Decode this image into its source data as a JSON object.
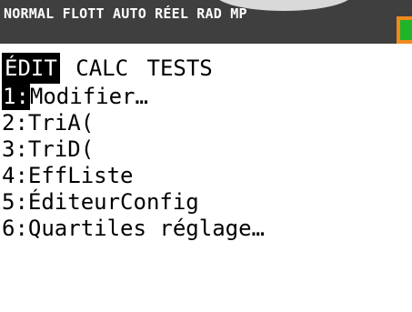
{
  "status_bar": {
    "text": "NORMAL FLOTT AUTO RÉEL RAD MP",
    "battery_color": "#f08a1b",
    "battery_level_color": "#1fb42a"
  },
  "menu": {
    "tabs": [
      {
        "label": "ÉDIT",
        "active": true
      },
      {
        "label": "CALC",
        "active": false
      },
      {
        "label": "TESTS",
        "active": false
      }
    ],
    "items": [
      {
        "num": "1:",
        "label": "Modifier…",
        "selected": true
      },
      {
        "num": "2:",
        "label": "TriA(",
        "selected": false
      },
      {
        "num": "3:",
        "label": "TriD(",
        "selected": false
      },
      {
        "num": "4:",
        "label": "EffListe",
        "selected": false
      },
      {
        "num": "5:",
        "label": "ÉditeurConfig",
        "selected": false
      },
      {
        "num": "6:",
        "label": "Quartiles réglage…",
        "selected": false
      }
    ]
  }
}
